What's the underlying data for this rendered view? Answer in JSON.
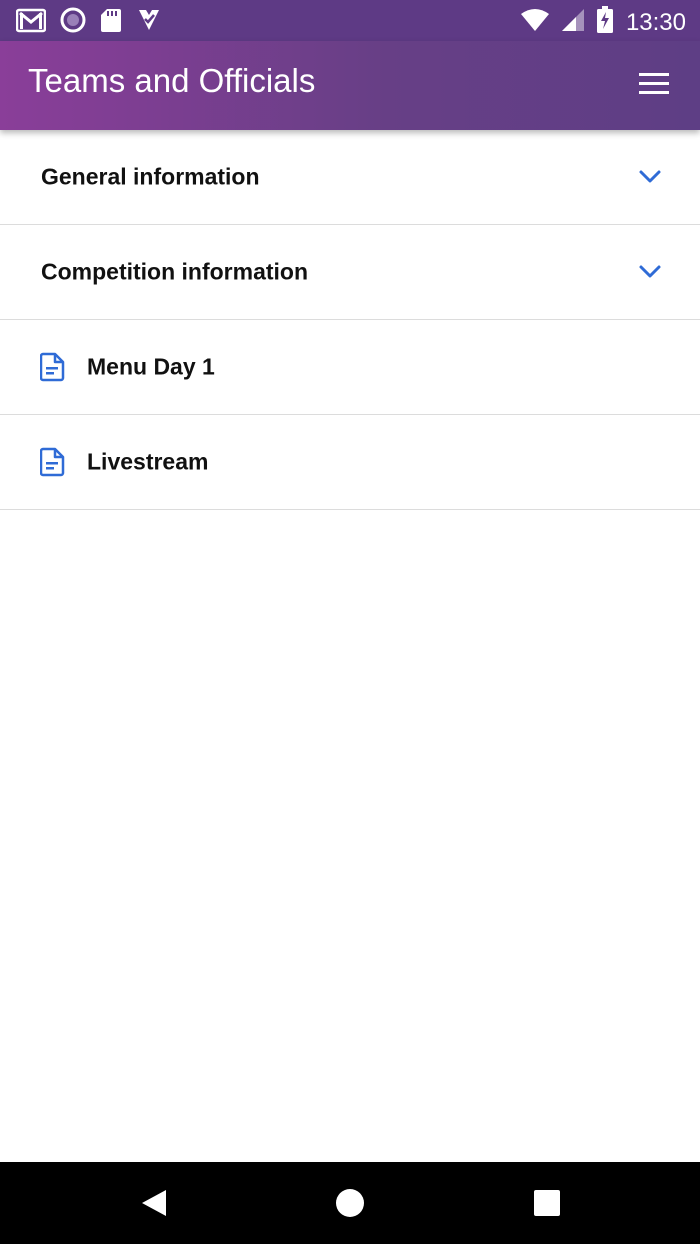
{
  "status_bar": {
    "time": "13:30",
    "left_icons": [
      "gmail-icon",
      "record-icon",
      "sd-card-icon",
      "check-app-icon"
    ],
    "right_icons": [
      "wifi-icon",
      "signal-icon",
      "battery-charging-icon"
    ]
  },
  "app_bar": {
    "title": "Teams and Officials",
    "menu_icon": "hamburger-menu-icon"
  },
  "list": {
    "items": [
      {
        "label": "General information",
        "kind": "section",
        "icon": "chevron-down-icon"
      },
      {
        "label": "Competition information",
        "kind": "section",
        "icon": "chevron-down-icon"
      },
      {
        "label": "Menu Day 1",
        "kind": "document",
        "icon": "document-icon"
      },
      {
        "label": "Livestream",
        "kind": "document",
        "icon": "document-icon"
      }
    ]
  },
  "nav_bar": {
    "icons": [
      "back-icon",
      "home-icon",
      "recent-apps-icon"
    ]
  },
  "colors": {
    "status_bar": "#5e3a85",
    "app_bar_start": "#8a3e99",
    "app_bar_end": "#5e3e85",
    "accent_blue": "#2f6bd6",
    "divider": "#dcdcdc",
    "nav_bar": "#000000"
  }
}
